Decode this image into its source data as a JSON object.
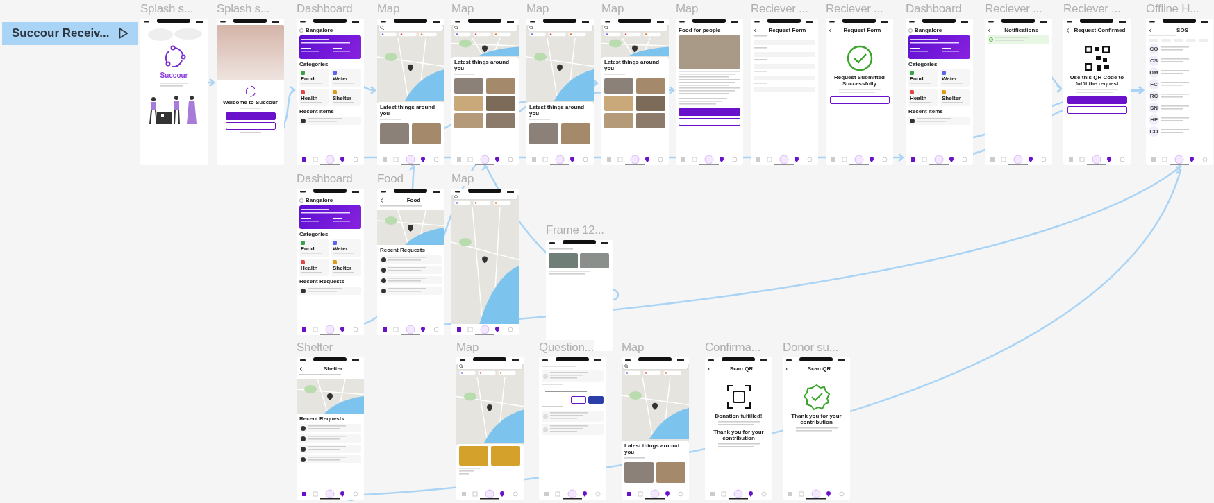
{
  "flow_start": {
    "label": "Succour Receiv..."
  },
  "frames": [
    {
      "title": "Splash s...",
      "kind": "splash",
      "heading": "Succour"
    },
    {
      "title": "Splash s...",
      "kind": "login",
      "heading": "Welcome to Succour"
    },
    {
      "title": "Dashboard",
      "kind": "dashboard",
      "heading": "Bangalore",
      "section": "Categories",
      "labels": [
        "Food",
        "Water",
        "Health",
        "Shelter"
      ],
      "footer": "Recent Items"
    },
    {
      "title": "Map",
      "kind": "map",
      "heading": "Latest things around you"
    },
    {
      "title": "Map",
      "kind": "map-grid",
      "heading": "Latest things around you"
    },
    {
      "title": "Map",
      "kind": "map",
      "heading": "Latest things around you"
    },
    {
      "title": "Map",
      "kind": "map-grid",
      "heading": "Latest things around you"
    },
    {
      "title": "Map",
      "kind": "detail",
      "heading": "Food for people"
    },
    {
      "title": "Reciever ...",
      "kind": "form",
      "heading": "Request Form"
    },
    {
      "title": "Reciever ...",
      "kind": "success",
      "heading": "Request Form",
      "texts": [
        "Request Submitted Successfully"
      ]
    },
    {
      "title": "Dashboard",
      "kind": "dashboard",
      "heading": "Bangalore",
      "section": "Categories",
      "labels": [
        "Food",
        "Water",
        "Health",
        "Shelter"
      ],
      "footer": "Recent Items"
    },
    {
      "title": "Reciever ...",
      "kind": "notifications",
      "heading": "Notifications"
    },
    {
      "title": "Reciever ...",
      "kind": "qr",
      "heading": "Request Confirmed",
      "texts": [
        "Use this QR Code to fulfil the request"
      ]
    },
    {
      "title": "Offline H...",
      "kind": "sos",
      "heading": "SOS",
      "initials": [
        "CO",
        "CS",
        "DM",
        "FC",
        "RC",
        "SN",
        "HF",
        "CO"
      ]
    },
    {
      "title": "Dashboard",
      "kind": "dashboard",
      "heading": "Bangalore",
      "section": "Categories",
      "labels": [
        "Food",
        "Water",
        "Health",
        "Shelter"
      ],
      "footer": "Recent Requests"
    },
    {
      "title": "Food",
      "kind": "list",
      "heading": "Food",
      "section": "Recent Requests"
    },
    {
      "title": "Map",
      "kind": "map-only"
    },
    {
      "title": "Frame 12...",
      "kind": "card"
    },
    {
      "title": "Shelter",
      "kind": "list",
      "heading": "Shelter",
      "section": "Recent Requests"
    },
    {
      "title": "Map",
      "kind": "map-results"
    },
    {
      "title": "Question...",
      "kind": "question"
    },
    {
      "title": "Map",
      "kind": "map",
      "heading": "Latest things around you"
    },
    {
      "title": "Confirma...",
      "kind": "scan",
      "heading": "Scan QR",
      "texts": [
        "Donation fulfilled!",
        "Thank you for your contribution"
      ]
    },
    {
      "title": "Donor su...",
      "kind": "badge",
      "heading": "Scan QR",
      "texts": [
        "Thank you for your contribution"
      ]
    }
  ]
}
